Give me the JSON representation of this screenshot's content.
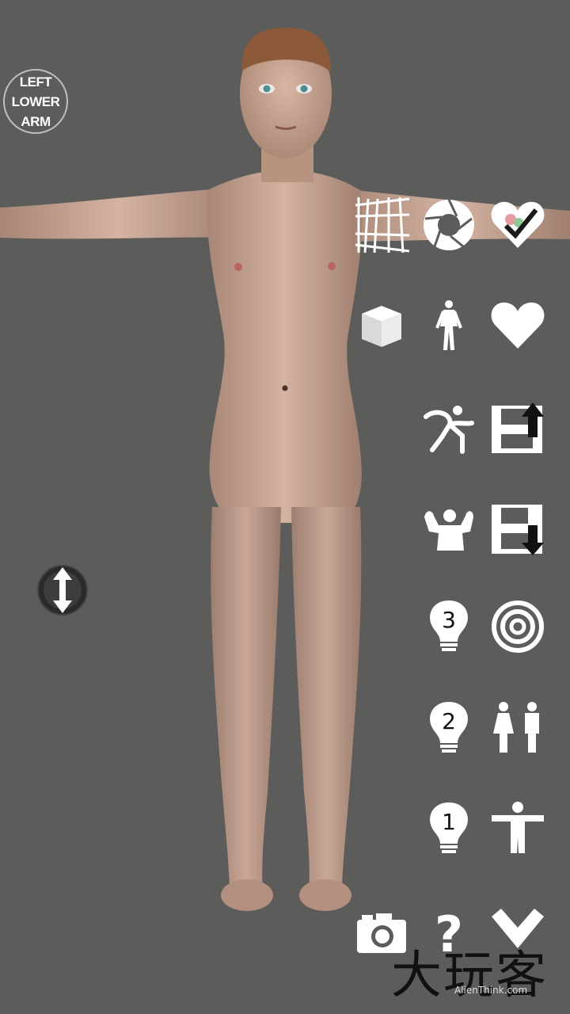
{
  "body_part_label": {
    "line1": "LEFT",
    "line2": "LOWER",
    "line3": "ARM"
  },
  "toolbar": {
    "icons": [
      "grid-perspective-icon",
      "aperture-icon",
      "heart-checkmark-icon",
      "cube-icon",
      "anatomy-figure-icon",
      "heart-icon",
      "dance-pose-icon",
      "save-upload-icon",
      "muscle-flex-icon",
      "save-download-icon",
      "light-bulb-3-icon",
      "target-icon",
      "light-bulb-2-icon",
      "male-female-icon",
      "light-bulb-1-icon",
      "t-pose-icon",
      "camera-icon",
      "help-icon",
      "chevron-down-icon"
    ],
    "bulb_3": "3",
    "bulb_2": "2",
    "bulb_1": "1",
    "help": "?"
  },
  "watermark": {
    "text": "大玩客",
    "sub": "AlienThink.com"
  },
  "colors": {
    "background": "#5c5d5b",
    "icon": "#ffffff",
    "skin": "#c7a491"
  }
}
